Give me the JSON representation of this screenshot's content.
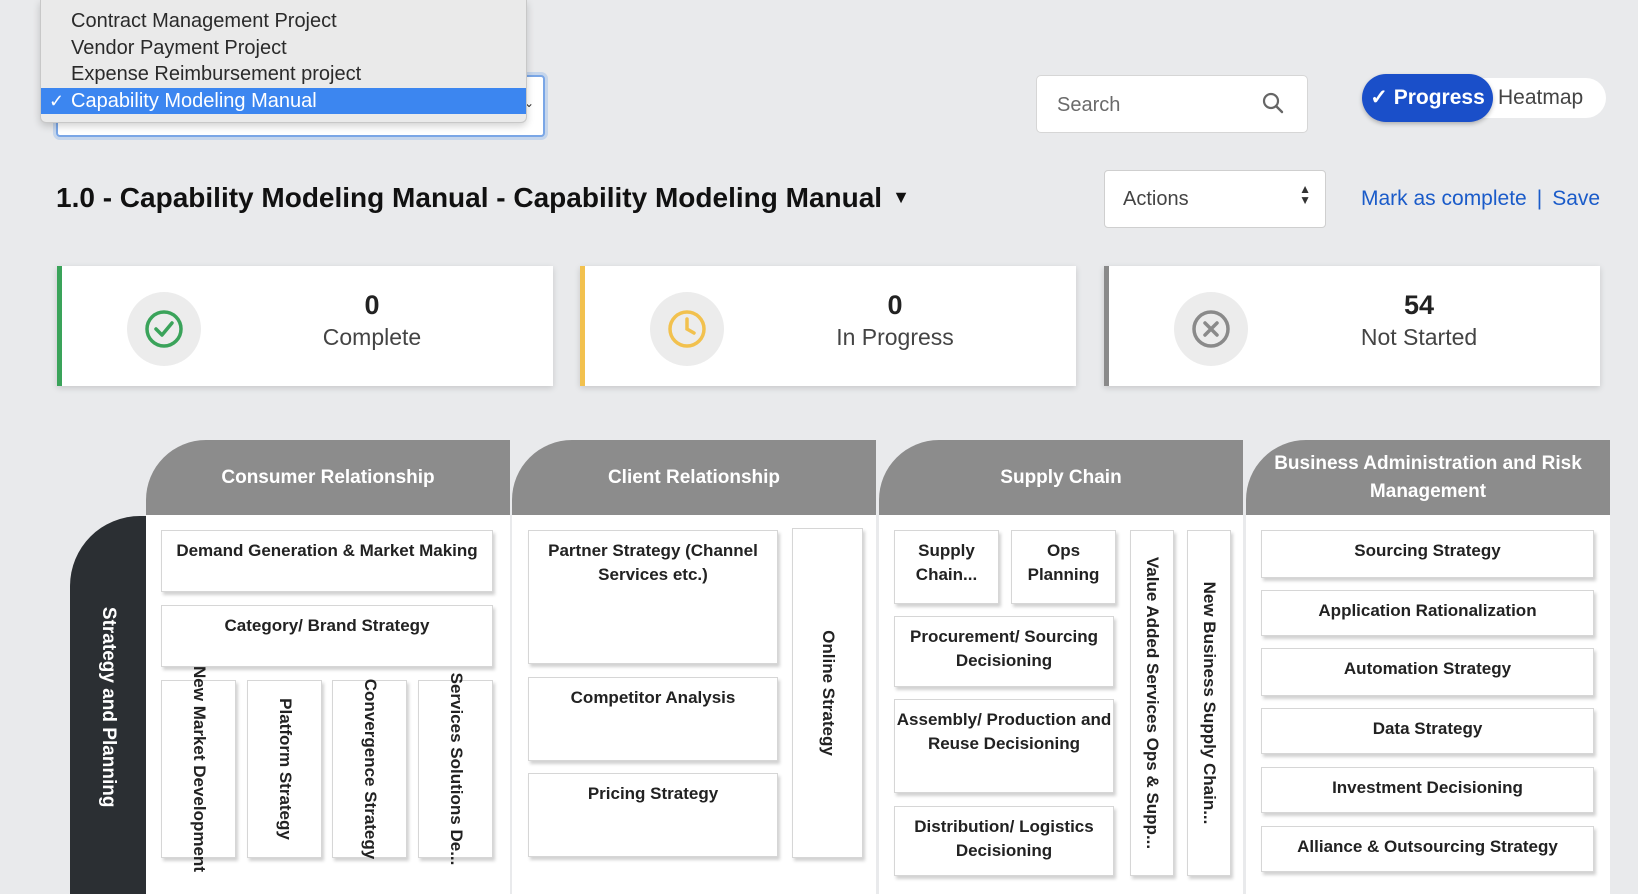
{
  "project_dropdown": {
    "options": [
      {
        "label": "Contract Management Project"
      },
      {
        "label": "Vendor Payment Project"
      },
      {
        "label": "Expense Reimbursement project"
      },
      {
        "label": "Capability Modeling Manual",
        "selected": true
      }
    ]
  },
  "search": {
    "placeholder": "Search"
  },
  "view_toggle": {
    "active": "Progress",
    "inactive": "Heatmap"
  },
  "page_title": "1.0 - Capability Modeling Manual - Capability Modeling Manual",
  "actions": {
    "label": "Actions"
  },
  "links": {
    "mark_complete": "Mark as complete",
    "separator": "|",
    "save": "Save"
  },
  "stats": [
    {
      "value": "0",
      "label": "Complete",
      "color": "#3aa35a",
      "icon": "check-circle-icon"
    },
    {
      "value": "0",
      "label": "In Progress",
      "color": "#f2c14e",
      "icon": "clock-icon"
    },
    {
      "value": "54",
      "label": "Not Started",
      "color": "#8a8a8a",
      "icon": "x-circle-icon"
    }
  ],
  "capability_map": {
    "row_header": "Strategy and Planning",
    "columns": [
      {
        "title": "Consumer Relationship",
        "boxes": [
          "Demand Generation & Market Making",
          "Category/ Brand Strategy"
        ],
        "vertical_boxes": [
          "New Market Development",
          "Platform Strategy",
          "Convergence Strategy",
          "Services Solutions De..."
        ]
      },
      {
        "title": "Client Relationship",
        "boxes": [
          "Partner Strategy (Channel Services etc.)",
          "Competitor Analysis",
          "Pricing Strategy"
        ],
        "vertical_boxes": [
          "Online Strategy"
        ]
      },
      {
        "title": "Supply Chain",
        "boxes": [
          "Supply Chain...",
          "Ops Planning",
          "Procurement/ Sourcing Decisioning",
          "Assembly/ Production and Reuse Decisioning",
          "Distribution/ Logistics Decisioning"
        ],
        "vertical_boxes": [
          "Value Added Services Ops & Supp...",
          "New Business Supply Chain..."
        ]
      },
      {
        "title": "Business Administration and Risk Management",
        "boxes": [
          "Sourcing Strategy",
          "Application Rationalization",
          "Automation Strategy",
          "Data Strategy",
          "Investment Decisioning",
          "Alliance & Outsourcing Strategy"
        ],
        "vertical_boxes": []
      }
    ]
  },
  "colors": {
    "accent": "#1a4fc9",
    "link": "#1a5bc9",
    "header_gray": "#8c8c8c",
    "row_dark": "#2b2f33"
  }
}
